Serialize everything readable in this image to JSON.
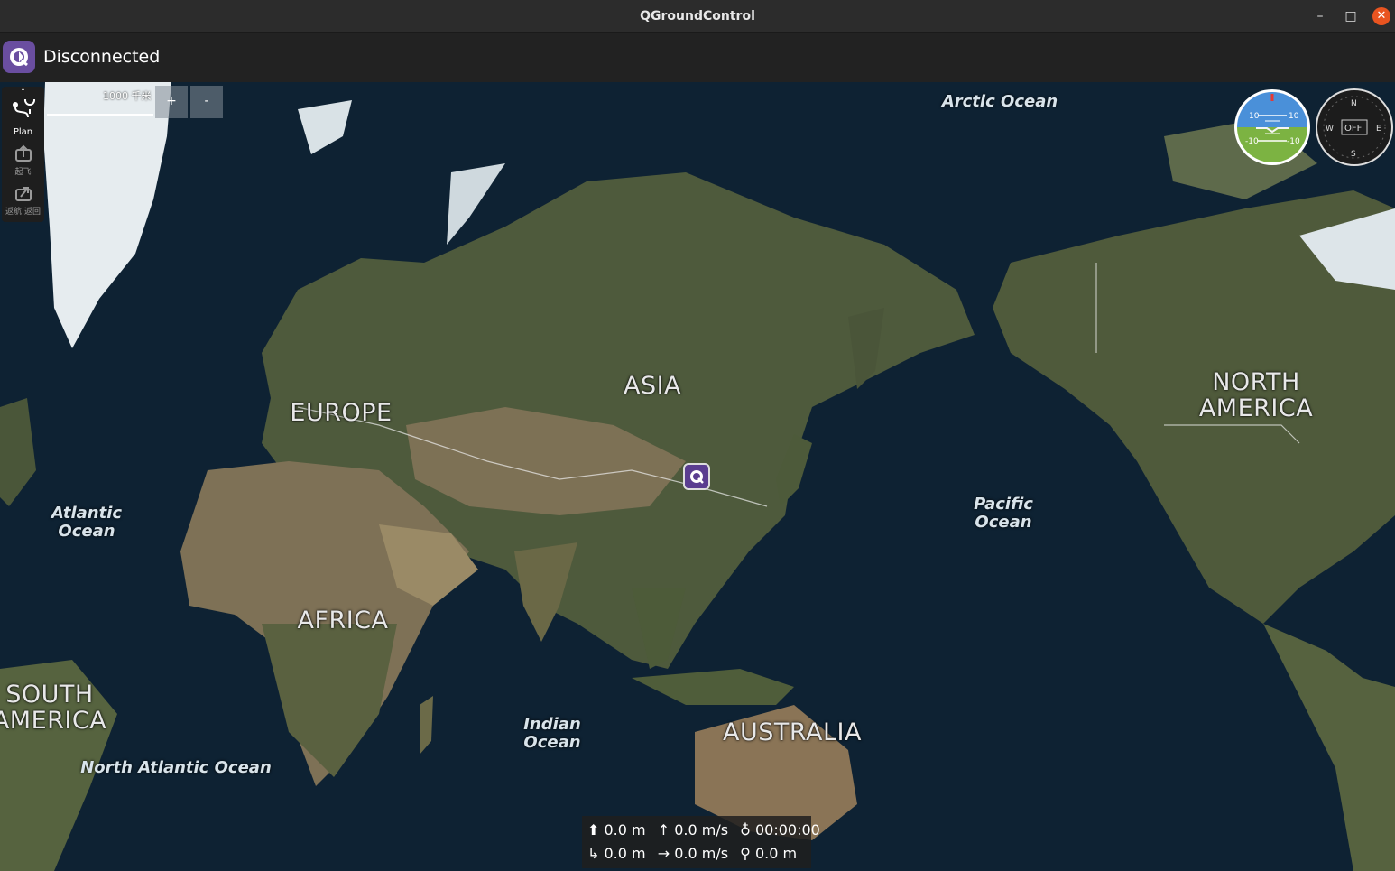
{
  "window": {
    "title": "QGroundControl",
    "minimize_glyph": "–",
    "maximize_glyph": "□",
    "close_glyph": "✕"
  },
  "toolbar": {
    "connection_status": "Disconnected",
    "logo_icon": "qgc-logo-icon"
  },
  "toolstrip": {
    "top_glyph": "ˆ",
    "items": [
      {
        "label": "Plan",
        "icon": "plan-route-icon",
        "enabled": true
      },
      {
        "label": "起飞",
        "icon": "takeoff-icon",
        "enabled": false
      },
      {
        "label": "返航|返回",
        "icon": "return-icon",
        "enabled": false
      }
    ]
  },
  "map": {
    "scale_text": "1000 千米",
    "zoom_in_label": "+",
    "zoom_out_label": "-",
    "ocean_labels": {
      "arctic": "Arctic Ocean",
      "atlantic": "Atlantic Ocean",
      "pacific": "Pacific Ocean",
      "indian": "Indian Ocean",
      "north_atlantic": "North Atlantic Ocean"
    },
    "continent_labels": {
      "asia": "ASIA",
      "europe": "EUROPE",
      "africa": "AFRICA",
      "north_america": "NORTH AMERICA",
      "south_america": "SOUTH AMERICA",
      "australia": "AUSTRALIA"
    }
  },
  "instruments": {
    "attitude": {
      "pitch_upper": "10",
      "pitch_upper_right": "10",
      "pitch_lower": "-10",
      "pitch_lower_right": "-10"
    },
    "compass": {
      "north": "N",
      "south": "S",
      "east": "E",
      "west": "W",
      "heading_text": "OFF"
    }
  },
  "telemetry": {
    "row1": [
      {
        "icon": "altitude-up-icon",
        "glyph": "⬆",
        "value": "0.0 m"
      },
      {
        "icon": "vertical-speed-icon",
        "glyph": "↑",
        "value": "0.0 m/s"
      },
      {
        "icon": "flight-time-icon",
        "glyph": "♁",
        "value": "00:00:00"
      }
    ],
    "row2": [
      {
        "icon": "distance-home-icon",
        "glyph": "↳",
        "value": "0.0 m"
      },
      {
        "icon": "horizontal-speed-icon",
        "glyph": "→",
        "value": "0.0 m/s"
      },
      {
        "icon": "distance-pilot-icon",
        "glyph": "⚲",
        "value": "0.0 m"
      }
    ]
  },
  "colors": {
    "titlebar_bg": "#2c2c2c",
    "toolbar_bg": "#222222",
    "close_button": "#e95420",
    "qgc_purple": "#6a4ea0",
    "ocean": "#0d1f2d",
    "land": "#4f5a3c",
    "desert": "#8a7b5c",
    "ice": "#e8eef2",
    "attitude_sky": "#4a90d9",
    "attitude_ground": "#7cb342"
  }
}
